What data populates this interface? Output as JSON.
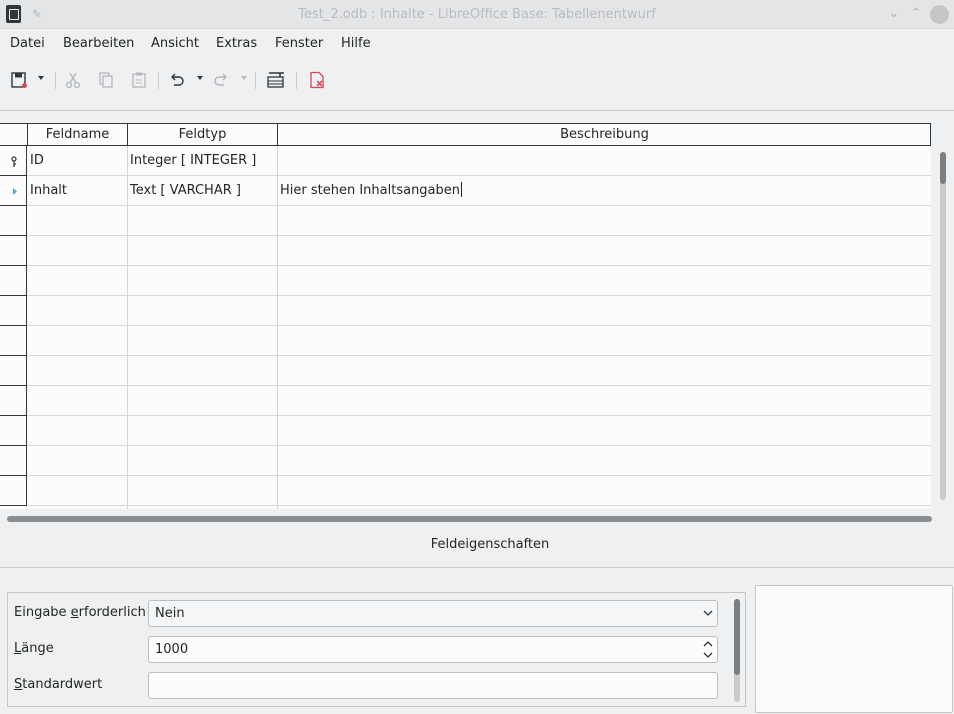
{
  "window": {
    "title": "Test_2.odb : Inhalte - LibreOffice Base: Tabellenentwurf"
  },
  "menu": [
    "Datei",
    "Bearbeiten",
    "Ansicht",
    "Extras",
    "Fenster",
    "Hilfe"
  ],
  "toolbar": {
    "icons": [
      "save-icon",
      "cut-icon",
      "copy-icon",
      "paste-icon",
      "undo-icon",
      "redo-icon",
      "index-design-icon",
      "close-document-icon"
    ]
  },
  "grid": {
    "columns": [
      "Feldname",
      "Feldtyp",
      "Beschreibung"
    ],
    "rows": [
      {
        "marker": "primary-key-icon",
        "name": "ID",
        "type": "Integer [ INTEGER ]",
        "description": ""
      },
      {
        "marker": "current-row-arrow-icon",
        "name": "Inhalt",
        "type": "Text [ VARCHAR ]",
        "description": "Hier stehen Inhaltsangaben"
      },
      {
        "name": "",
        "type": "",
        "description": ""
      },
      {
        "name": "",
        "type": "",
        "description": ""
      },
      {
        "name": "",
        "type": "",
        "description": ""
      },
      {
        "name": "",
        "type": "",
        "description": ""
      },
      {
        "name": "",
        "type": "",
        "description": ""
      },
      {
        "name": "",
        "type": "",
        "description": ""
      },
      {
        "name": "",
        "type": "",
        "description": ""
      },
      {
        "name": "",
        "type": "",
        "description": ""
      },
      {
        "name": "",
        "type": "",
        "description": ""
      },
      {
        "name": "",
        "type": "",
        "description": ""
      }
    ]
  },
  "properties": {
    "title": "Feldeigenschaften",
    "required": {
      "label_pre": "Eingabe ",
      "label_key": "e",
      "label_post": "rforderlich",
      "value": "Nein"
    },
    "length": {
      "label_key": "L",
      "label_post": "änge",
      "value": "1000"
    },
    "default": {
      "label_key": "S",
      "label_post": "tandardwert",
      "value": ""
    }
  }
}
